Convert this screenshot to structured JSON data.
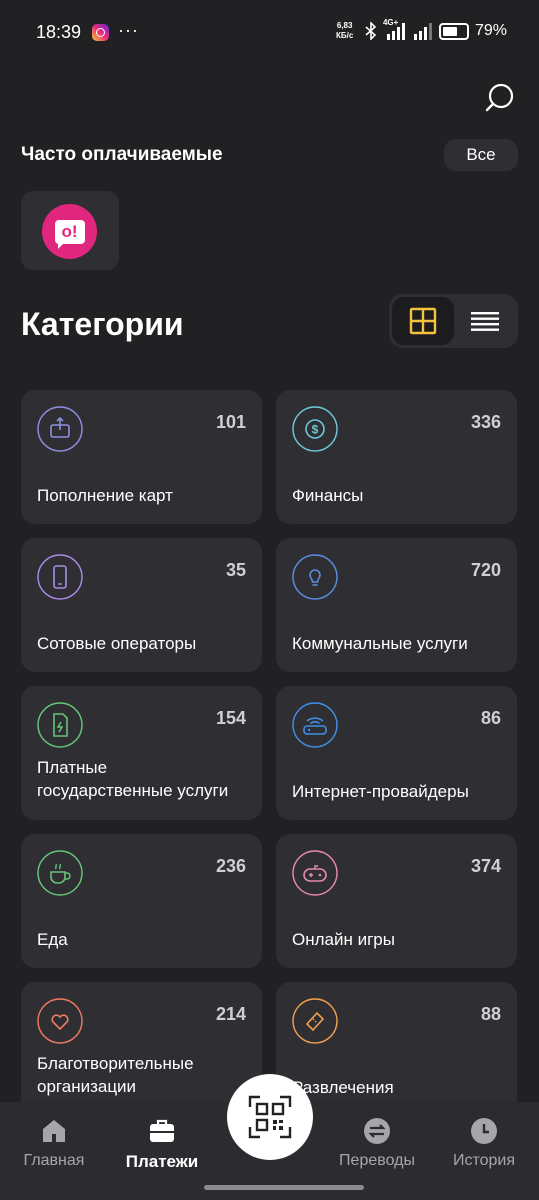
{
  "status_bar": {
    "time": "18:39",
    "net_speed_value": "6,83",
    "net_speed_unit": "КБ/с",
    "network_type": "4G+",
    "battery_text": "79%",
    "battery_level": 0.79
  },
  "frequent": {
    "title": "Часто оплачиваемые",
    "all_label": "Все",
    "items": [
      {
        "logo_text": "o!",
        "logo_color": "#e0267d"
      }
    ]
  },
  "categories": {
    "title": "Категории",
    "view_mode": "grid",
    "items": [
      {
        "label": "Пополнение карт",
        "count": "101",
        "icon": "card-topup-icon",
        "color": "#8f8fe0"
      },
      {
        "label": "Финансы",
        "count": "336",
        "icon": "dollar-coin-icon",
        "color": "#6ec7d8"
      },
      {
        "label": "Сотовые операторы",
        "count": "35",
        "icon": "mobile-phone-icon",
        "color": "#a98ae6"
      },
      {
        "label": "Коммунальные услуги",
        "count": "720",
        "icon": "lightbulb-icon",
        "color": "#5a8de0"
      },
      {
        "label_line1": "Платные",
        "label_line2": "государственные услуги",
        "count": "154",
        "icon": "document-icon",
        "color": "#66c477"
      },
      {
        "label": "Интернет-провайдеры",
        "count": "86",
        "icon": "router-icon",
        "color": "#3f8fe6"
      },
      {
        "label": "Еда",
        "count": "236",
        "icon": "coffee-cup-icon",
        "color": "#66c477"
      },
      {
        "label": "Онлайн игры",
        "count": "374",
        "icon": "gamepad-icon",
        "color": "#e58aa4"
      },
      {
        "label_line1": "Благотворительные",
        "label_line2": "организации",
        "count": "214",
        "icon": "heart-icon",
        "color": "#ef7a62"
      },
      {
        "label": "Развлечения",
        "count": "88",
        "icon": "ticket-icon",
        "color": "#efa04f"
      }
    ]
  },
  "bottom_nav": {
    "items": [
      {
        "label": "Главная",
        "icon": "home-icon",
        "active": false
      },
      {
        "label": "Платежи",
        "icon": "briefcase-icon",
        "active": true
      },
      {
        "label": "Переводы",
        "icon": "transfer-arrows-icon",
        "active": false
      },
      {
        "label": "История",
        "icon": "clock-icon",
        "active": false
      }
    ],
    "qr_icon": "qr-code-icon"
  },
  "colors": {
    "background": "#212124",
    "card": "#2f2f33",
    "accent_yellow": "#f5c23d"
  }
}
